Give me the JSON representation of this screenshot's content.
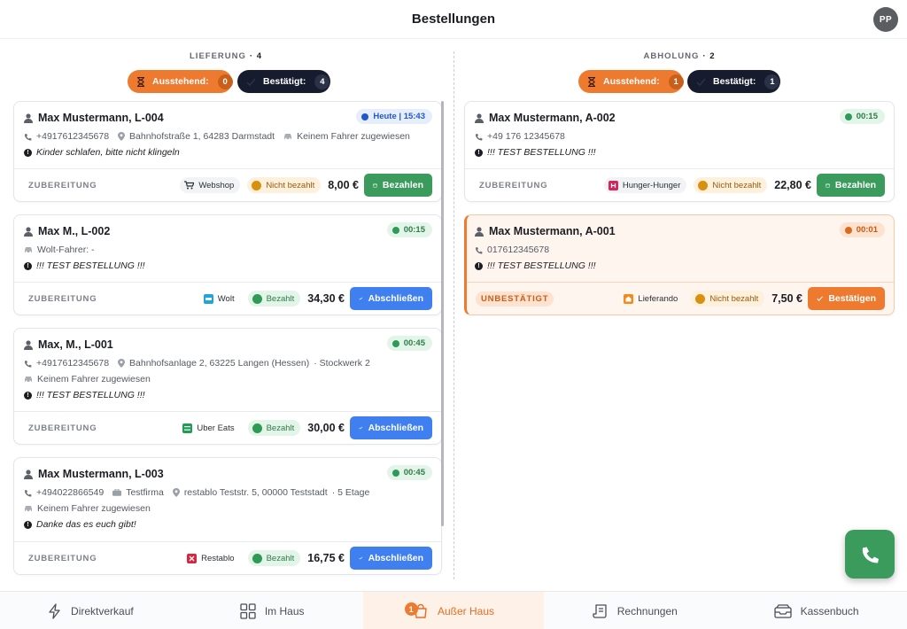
{
  "header": {
    "title": "Bestellungen",
    "avatar_initials": "PP"
  },
  "columns": {
    "delivery": {
      "label": "LIEFERUNG",
      "count": "· 4",
      "pending_label": "Ausstehend:",
      "pending_count": "0",
      "confirmed_label": "Bestätigt:",
      "confirmed_count": "4",
      "orders": [
        {
          "name": "Max Mustermann, L-004",
          "tag": "Heute | 15:43",
          "phone": "+4917612345678",
          "address": "Bahnhofstraße 1, 64283 Darmstadt",
          "driver": "Keinem Fahrer zugewiesen",
          "note": "Kinder schlafen, bitte nicht klingeln",
          "status": "ZUBEREITUNG",
          "source": "Webshop",
          "payment": "Nicht bezahlt",
          "amount": "8,00 €",
          "action": "Bezahlen"
        },
        {
          "name": "Max M., L-002",
          "tag": "00:15",
          "driver": "Wolt-Fahrer: -",
          "note": "!!! TEST BESTELLUNG !!!",
          "status": "ZUBEREITUNG",
          "source": "Wolt",
          "payment": "Bezahlt",
          "amount": "34,30 €",
          "action": "Abschließen"
        },
        {
          "name": "Max, M., L-001",
          "tag": "00:45",
          "phone": "+4917612345678",
          "address": "Bahnhofsanlage 2, 63225 Langen (Hessen)",
          "floor": "· Stockwerk 2",
          "driver": "Keinem Fahrer zugewiesen",
          "note": "!!! TEST BESTELLUNG !!!",
          "status": "ZUBEREITUNG",
          "source": "Uber Eats",
          "payment": "Bezahlt",
          "amount": "30,00 €",
          "action": "Abschließen"
        },
        {
          "name": "Max Mustermann, L-003",
          "tag": "00:45",
          "phone": "+494022866549",
          "company": "Testfirma",
          "address": "restablo Teststr. 5, 00000 Teststadt",
          "floor": "· 5 Etage",
          "driver": "Keinem Fahrer zugewiesen",
          "note": "Danke das es euch gibt!",
          "status": "ZUBEREITUNG",
          "source": "Restablo",
          "payment": "Bezahlt",
          "amount": "16,75 €",
          "action": "Abschließen"
        }
      ]
    },
    "pickup": {
      "label": "ABHOLUNG",
      "count": "· 2",
      "pending_label": "Ausstehend:",
      "pending_count": "1",
      "confirmed_label": "Bestätigt:",
      "confirmed_count": "1",
      "orders": [
        {
          "name": "Max Mustermann, A-002",
          "tag": "00:15",
          "phone": "+49 176 12345678",
          "note": "!!! TEST BESTELLUNG !!!",
          "status": "ZUBEREITUNG",
          "source": "Hunger-Hunger",
          "payment": "Nicht bezahlt",
          "amount": "22,80 €",
          "action": "Bezahlen"
        },
        {
          "name": "Max Mustermann, A-001",
          "tag": "00:01",
          "phone": "017612345678",
          "note": "!!! TEST BESTELLUNG !!!",
          "status": "UNBESTÄTIGT",
          "source": "Lieferando",
          "payment": "Nicht bezahlt",
          "amount": "7,50 €",
          "action": "Bestätigen"
        }
      ]
    }
  },
  "bottom_nav": {
    "items": [
      {
        "label": "Direktverkauf",
        "icon": "lightning-icon"
      },
      {
        "label": "Im Haus",
        "icon": "grid-icon"
      },
      {
        "label": "Außer Haus",
        "icon": "bag-icon",
        "badge": "1"
      },
      {
        "label": "Rechnungen",
        "icon": "receipt-icon"
      },
      {
        "label": "Kassenbuch",
        "icon": "cashbox-icon"
      }
    ]
  },
  "colors": {
    "accent": "#ee7a30",
    "dark": "#161b2e",
    "paid_green": "#3a9b5c",
    "action_blue": "#3f7ff0"
  }
}
